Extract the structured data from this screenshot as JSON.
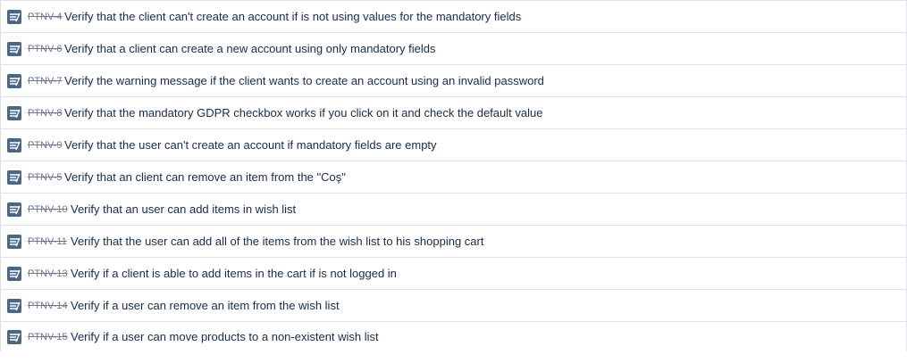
{
  "issues": [
    {
      "key": "PTNV-4",
      "summary": "Verify that the client can't create an account if is not using values for the mandatory fields"
    },
    {
      "key": "PTNV-6",
      "summary": "Verify that a client can create a new account using only mandatory fields"
    },
    {
      "key": "PTNV-7",
      "summary": "Verify the warning message if the client wants to create an account using an invalid password"
    },
    {
      "key": "PTNV-8",
      "summary": "Verify that the mandatory GDPR checkbox works if you click on it and check the default value"
    },
    {
      "key": "PTNV-9",
      "summary": "Verify that the user can't create an account if mandatory fields are empty"
    },
    {
      "key": "PTNV-5",
      "summary": "Verify that an client can remove an item from the \"Coş\""
    },
    {
      "key": "PTNV-10",
      "summary": "Verify that an user can add items in wish list"
    },
    {
      "key": "PTNV-11",
      "summary": "Verify that the user can add all of the items from the wish list to his shopping cart"
    },
    {
      "key": "PTNV-13",
      "summary": "Verify if a client is able to add items in the cart if is not logged in"
    },
    {
      "key": "PTNV-14",
      "summary": "Verify if a user can remove an item from the wish list"
    },
    {
      "key": "PTNV-15",
      "summary": "Verify if a user can move products to a non-existent wish list"
    }
  ],
  "icon_name": "test-issue-type-icon",
  "colors": {
    "icon_bg": "#4a6785",
    "key": "#6b778c",
    "text": "#172b4d",
    "border": "#dfe1e6"
  }
}
